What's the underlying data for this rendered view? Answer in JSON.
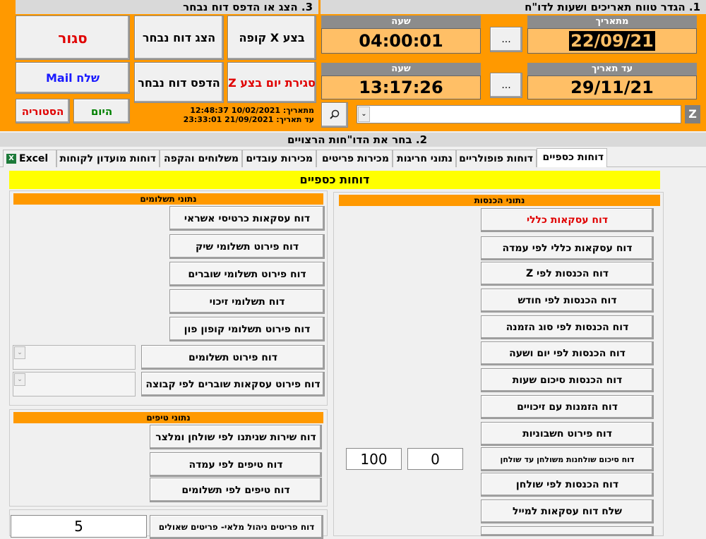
{
  "header": {
    "section1_title": "1. הגדר  טווח  תאריכים ושעות לדו\"ח",
    "section3_title": "3. הצג או הדפס דוח נבחר",
    "section2_title": "2. בחר את הדו\"חות הרצויים"
  },
  "dates": {
    "from_date_label": "מתאריך",
    "from_date_value": "22/09/21",
    "from_time_label": "שעה",
    "from_time_value": "04:00:01",
    "to_date_label": "עד תאריך",
    "to_date_value": "29/11/21",
    "to_time_label": "שעה",
    "to_time_value": "13:17:26",
    "ellipsis": "..."
  },
  "actions": {
    "close": "סגור",
    "show_selected": "הצג דוח נבחר",
    "x_register": "בצע X קופה",
    "send_mail": "שלח Mail",
    "print_selected": "הדפס דוח נבחר",
    "close_day_z": "סגירת יום בצע Z",
    "history": "הסטוריה",
    "today": "היום",
    "range_from": "מתאריך: 10/02/2021 12:48:37",
    "range_to": "עד תאריך: 21/09/2021 23:33:01"
  },
  "search": {
    "z_label": "Z",
    "search_icon": "magnifier-icon"
  },
  "tabs": [
    "דוחות כספיים",
    "דוחות פופולריים",
    "נתוני חריגות",
    "מכירות פריטים",
    "מכירות עובדים",
    "משלוחים והקפה",
    "דוחות מועדון לקוחות",
    "Excel"
  ],
  "content": {
    "banner": "דוחות כספיים",
    "income_head": "נתוני הכנסות",
    "payments_head": "נתוני תשלומים",
    "tips_head": "נתוני טיפים",
    "income_buttons": [
      "דוח עסקאות כללי",
      "דוח עסקאות כללי לפי עמדה",
      "דוח הכנסות לפי Z",
      "דוח הכנסות לפי חודש",
      "דוח הכנסות לפי סוג הזמנה",
      "דוח הכנסות לפי יום ושעה",
      "דוח הכנסות סיכום שעות",
      "דוח הזמנות עם זיכויים",
      "דוח פירוט חשבוניות",
      "דוח סיכום שולחנות משולחן עד שולחן",
      "דוח הכנסות לפי שולחן",
      "שלח דוח עסקאות למייל"
    ],
    "payment_buttons": [
      "דוח עסקאות כרטיסי אשראי",
      "דוח פירוט תשלומי שיק",
      "דוח פירוט תשלומי שוברים",
      "דוח תשלומי זיכוי",
      "דוח פירוט תשלומי קופון פון",
      "דוח פירוט תשלומים",
      "דוח פירוט עסקאות שוברים לפי קבוצה"
    ],
    "tips_buttons": [
      "דוח שירות שניתנו לפי שולחן ומלצר",
      "דוח טיפים לפי עמדה",
      "דוח טיפים לפי תשלומים"
    ],
    "table_from": "0",
    "table_to": "100",
    "inventory_button": "דוח פריטים ניהול מלאי- פריטים שאולים",
    "inventory_value": "5"
  },
  "colors": {
    "orange": "#ff9900",
    "value_bg": "#ffbf66",
    "red_text": "#e00000",
    "blue_text": "#1a1aff",
    "green_text": "#008000",
    "banner_yellow": "#ffff00"
  }
}
